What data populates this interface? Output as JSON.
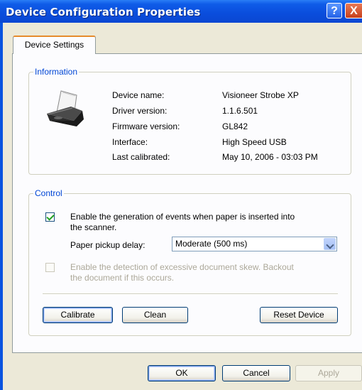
{
  "window": {
    "title": "Device Configuration Properties",
    "help_label": "?",
    "close_label": "X"
  },
  "tabs": [
    {
      "label": "Device Settings",
      "selected": true
    }
  ],
  "information": {
    "group_title": "Information",
    "rows": [
      {
        "label": "Device name:",
        "value": "Visioneer Strobe XP"
      },
      {
        "label": "Driver version:",
        "value": "1.1.6.501"
      },
      {
        "label": "Firmware version:",
        "value": "GL842"
      },
      {
        "label": "Interface:",
        "value": "High Speed USB"
      },
      {
        "label": "Last calibrated:",
        "value": "May 10, 2006 - 03:03 PM"
      }
    ]
  },
  "control": {
    "group_title": "Control",
    "events_checkbox": {
      "label_line1": "Enable the generation of events when paper is inserted into",
      "label_line2": "the scanner.",
      "checked": true
    },
    "pickup_delay": {
      "label": "Paper pickup delay:",
      "value": "Moderate (500 ms)"
    },
    "skew_checkbox": {
      "label_line1": "Enable the detection of excessive document skew. Backout",
      "label_line2": "the document if this occurs.",
      "checked": false,
      "enabled": false
    },
    "buttons": {
      "calibrate": "Calibrate",
      "clean": "Clean",
      "reset": "Reset Device"
    }
  },
  "footer": {
    "ok": "OK",
    "cancel": "Cancel",
    "apply": "Apply"
  }
}
